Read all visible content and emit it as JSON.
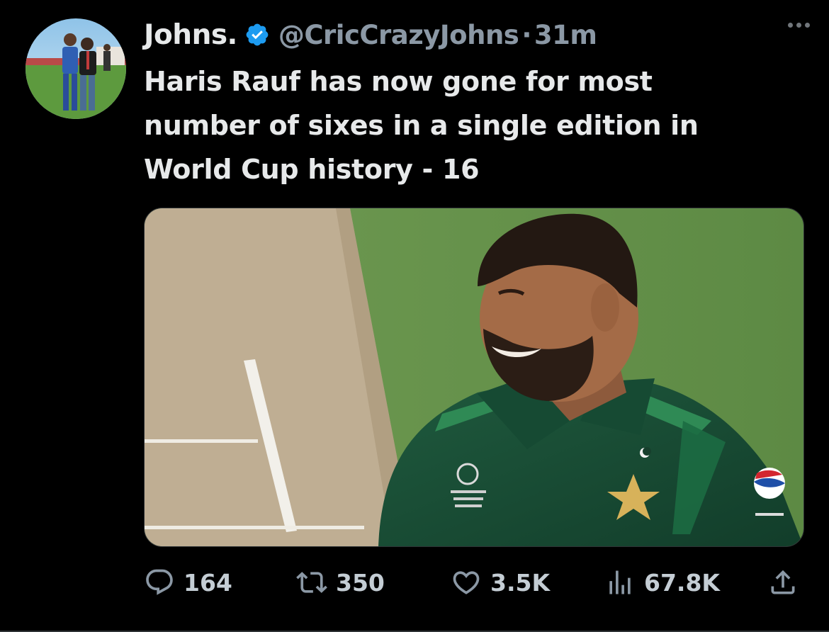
{
  "tweet": {
    "display_name": "Johns.",
    "handle": "@CricCrazyJohns",
    "separator": "·",
    "time": "31m",
    "text": "Haris Rauf has now gone for most number of sixes in a single edition in World Cup history - 16"
  },
  "icons": {
    "verified": "verified-badge-icon",
    "more": "more-options-icon",
    "reply": "reply-icon",
    "retweet": "retweet-icon",
    "like": "heart-icon",
    "views": "views-bar-icon",
    "share": "share-icon"
  },
  "actions": {
    "replies": "164",
    "retweets": "350",
    "likes": "3.5K",
    "views": "67.8K"
  },
  "colors": {
    "background": "#000000",
    "verified_blue": "#1d9bf0",
    "text_primary": "#e7e9ea",
    "text_secondary": "#8b98a5"
  }
}
